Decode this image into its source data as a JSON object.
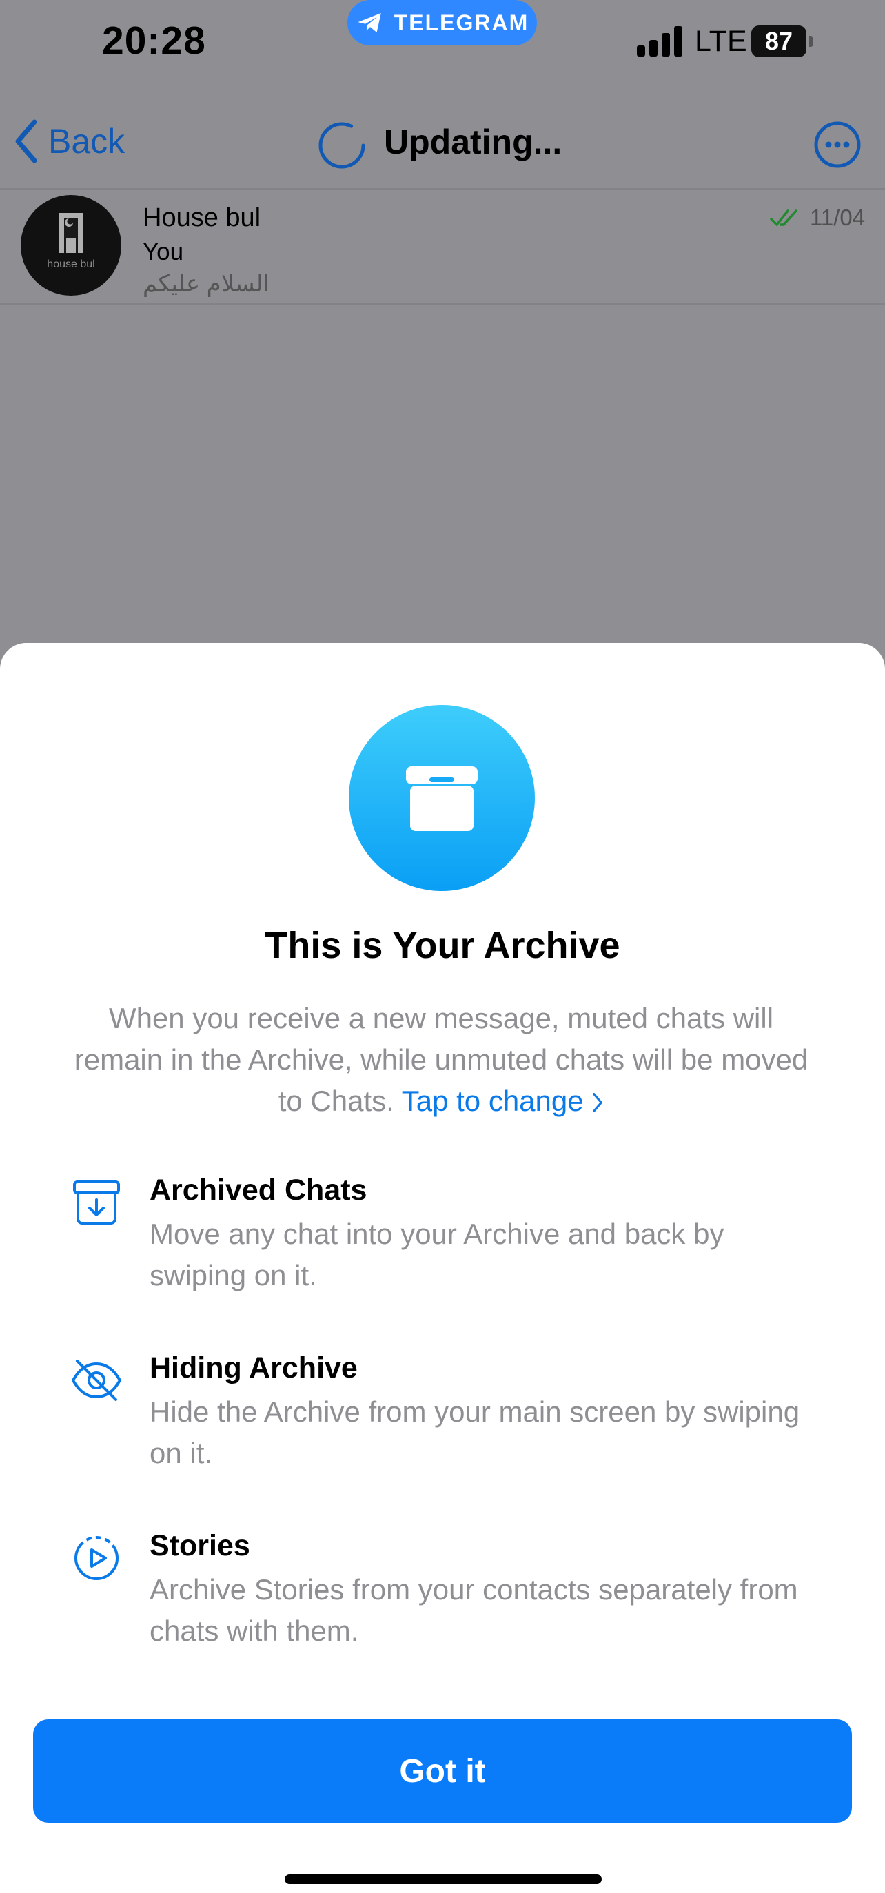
{
  "status_bar": {
    "time": "20:28",
    "app_pill": "TELEGRAM",
    "network": "LTE",
    "battery": "87"
  },
  "nav": {
    "back_label": "Back",
    "title": "Updating..."
  },
  "chat": {
    "name": "House bul",
    "sender": "You",
    "preview": "السلام عليكم",
    "date": "11/04",
    "avatar_text": "house bul"
  },
  "sheet": {
    "title": "This is Your Archive",
    "description": "When you receive a new message, muted chats will remain in the Archive, while unmuted chats will be moved to Chats.",
    "link_label": "Tap to change",
    "features": [
      {
        "title": "Archived Chats",
        "desc": "Move any chat into your Archive and back by swiping on it.",
        "icon": "archive-down-icon"
      },
      {
        "title": "Hiding Archive",
        "desc": "Hide the Archive from your main screen by swiping on it.",
        "icon": "eye-slash-icon"
      },
      {
        "title": "Stories",
        "desc": "Archive Stories from your contacts separately from chats with them.",
        "icon": "stories-play-icon"
      }
    ],
    "button_label": "Got it"
  },
  "colors": {
    "accent": "#0a7cf9",
    "link": "#0a7ae8",
    "dim_background": "#8f8f93",
    "archive_gradient_top": "#3ecdfb",
    "archive_gradient_bottom": "#0a9ff5"
  }
}
